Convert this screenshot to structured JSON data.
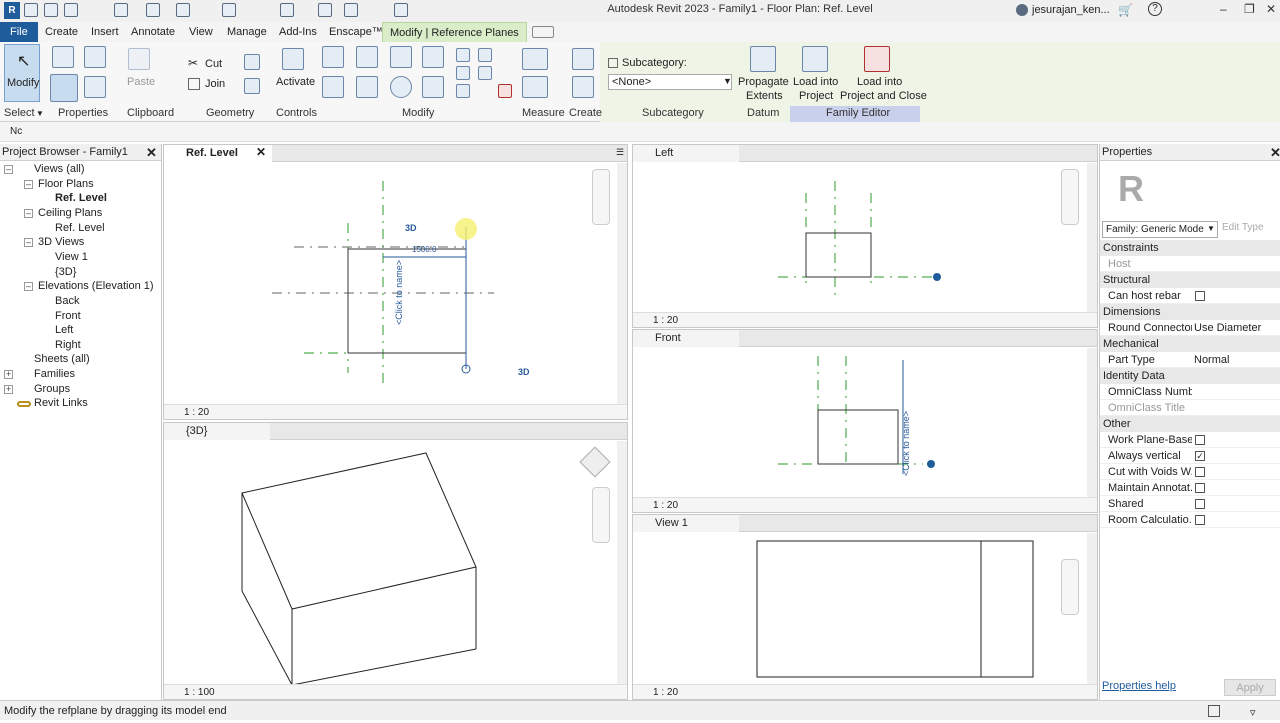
{
  "titlebar": {
    "app_title": "Autodesk Revit 2023 - Family1 - Floor Plan: Ref. Level",
    "user": "jesurajan_ken..."
  },
  "tabs": [
    "File",
    "Create",
    "Insert",
    "Annotate",
    "View",
    "Manage",
    "Add-Ins",
    "Enscape™",
    "Modify | Reference Planes"
  ],
  "ribbon": {
    "modify": "Modify",
    "paste": "Paste",
    "cut": "Cut",
    "join": "Join",
    "activate": "Activate",
    "subcategory_label": "Subcategory:",
    "subcategory_value": "<None>",
    "propagate": "Propagate Extents",
    "propagate_1": "Propagate",
    "propagate_2": "Extents",
    "load_project_1": "Load into",
    "load_project_2": "Project",
    "load_close_1": "Load into",
    "load_close_2": "Project and Close",
    "panels": {
      "select": "Select",
      "properties": "Properties",
      "clipboard": "Clipboard",
      "geometry": "Geometry",
      "controls": "Controls",
      "modify": "Modify",
      "measure": "Measure",
      "create": "Create",
      "subcategory": "Subcategory",
      "datum": "Datum",
      "family_editor": "Family Editor"
    }
  },
  "optionsbar": {
    "text": "Nc"
  },
  "browser": {
    "title": "Project Browser - Family1",
    "items": [
      "Views (all)",
      "Floor Plans",
      "Ref. Level",
      "Ceiling Plans",
      "Ref. Level",
      "3D Views",
      "View 1",
      "{3D}",
      "Elevations (Elevation 1)",
      "Back",
      "Front",
      "Left",
      "Right",
      "Sheets (all)",
      "Families",
      "Groups",
      "Revit Links"
    ]
  },
  "views": {
    "ref_level": {
      "title": "Ref. Level",
      "scale": "1 : 20",
      "dim": "1500.0",
      "label1": "3D",
      "label2": "3D",
      "click": "<Click to name>"
    },
    "threed": {
      "title": "{3D}",
      "scale": "1 : 100"
    },
    "left": {
      "title": "Left",
      "scale": "1 : 20"
    },
    "front": {
      "title": "Front",
      "scale": "1 : 20",
      "click": "<Click to name>"
    },
    "view1": {
      "title": "View 1",
      "scale": "1 : 20"
    }
  },
  "properties": {
    "title": "Properties",
    "logo": "R",
    "family": "Family: Generic Model",
    "edit_type": "Edit Type",
    "sections": {
      "constraints": "Constraints",
      "structural": "Structural",
      "dimensions": "Dimensions",
      "mechanical": "Mechanical",
      "identity": "Identity Data",
      "other": "Other"
    },
    "rows": {
      "host": "Host",
      "can_host_rebar": "Can host rebar",
      "round_connector": "Round Connector...",
      "round_connector_val": "Use Diameter",
      "part_type": "Part Type",
      "part_type_val": "Normal",
      "omniclass_num": "OmniClass Numb...",
      "omniclass_title": "OmniClass Title",
      "work_plane": "Work Plane-Based",
      "always_vertical": "Always vertical",
      "cut_voids": "Cut with Voids W...",
      "maintain_annot": "Maintain Annotat...",
      "shared": "Shared",
      "room_calc": "Room Calculatio..."
    },
    "help": "Properties help",
    "apply": "Apply"
  },
  "status": {
    "text": "Modify the refplane by dragging its model end"
  },
  "colors": {
    "file_tab": "#1f5c9c",
    "active_tab": "#d9edc8",
    "refplane": "#2a9a2a",
    "family_editor": "#c9d0ec"
  }
}
